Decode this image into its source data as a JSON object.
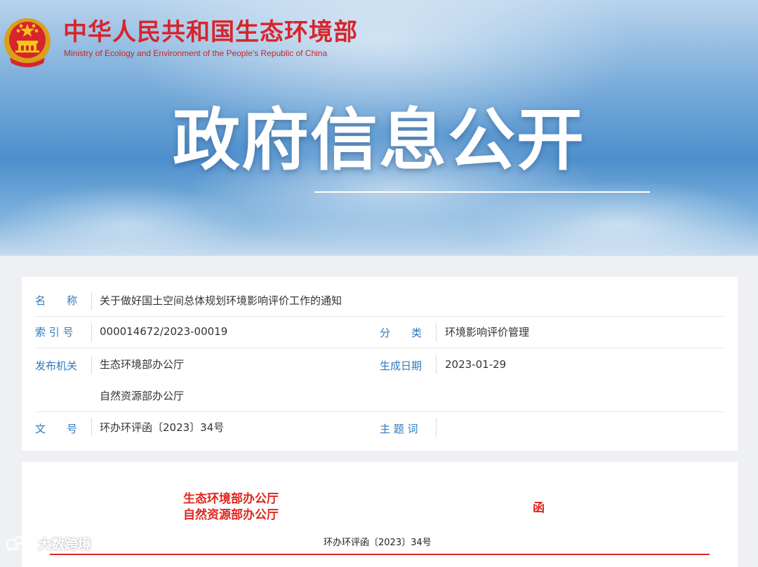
{
  "header": {
    "ministry_name_cn": "中华人民共和国生态环境部",
    "ministry_name_en": "Ministry of Ecology and Environment of the People's Republic of China",
    "hero_title": "政府信息公开",
    "emblem_icon": "national-emblem-icon"
  },
  "metadata": {
    "name": {
      "label": "名　　称",
      "value": "关于做好国土空间总体规划环境影响评价工作的通知"
    },
    "index_number": {
      "label": "索 引 号",
      "value": "000014672/2023-00019"
    },
    "category": {
      "label": "分　　类",
      "value": "环境影响评价管理"
    },
    "issuer": {
      "label": "发布机关",
      "values": [
        "生态环境部办公厅",
        "自然资源部办公厅"
      ]
    },
    "date": {
      "label": "生成日期",
      "value": "2023-01-29"
    },
    "doc_number": {
      "label": "文　　号",
      "value": "环办环评函〔2023〕34号"
    },
    "keywords": {
      "label": "主 题 词",
      "value": ""
    }
  },
  "document": {
    "issuers": [
      "生态环境部办公厅",
      "自然资源部办公厅"
    ],
    "doc_type": "函",
    "doc_number": "环办环评函〔2023〕34号"
  },
  "watermark": {
    "text": "大数跨境",
    "icon": "logo-icon"
  },
  "colors": {
    "brand_red": "#d7252c",
    "label_blue": "#2e79bd",
    "doc_red": "#e0261e"
  }
}
